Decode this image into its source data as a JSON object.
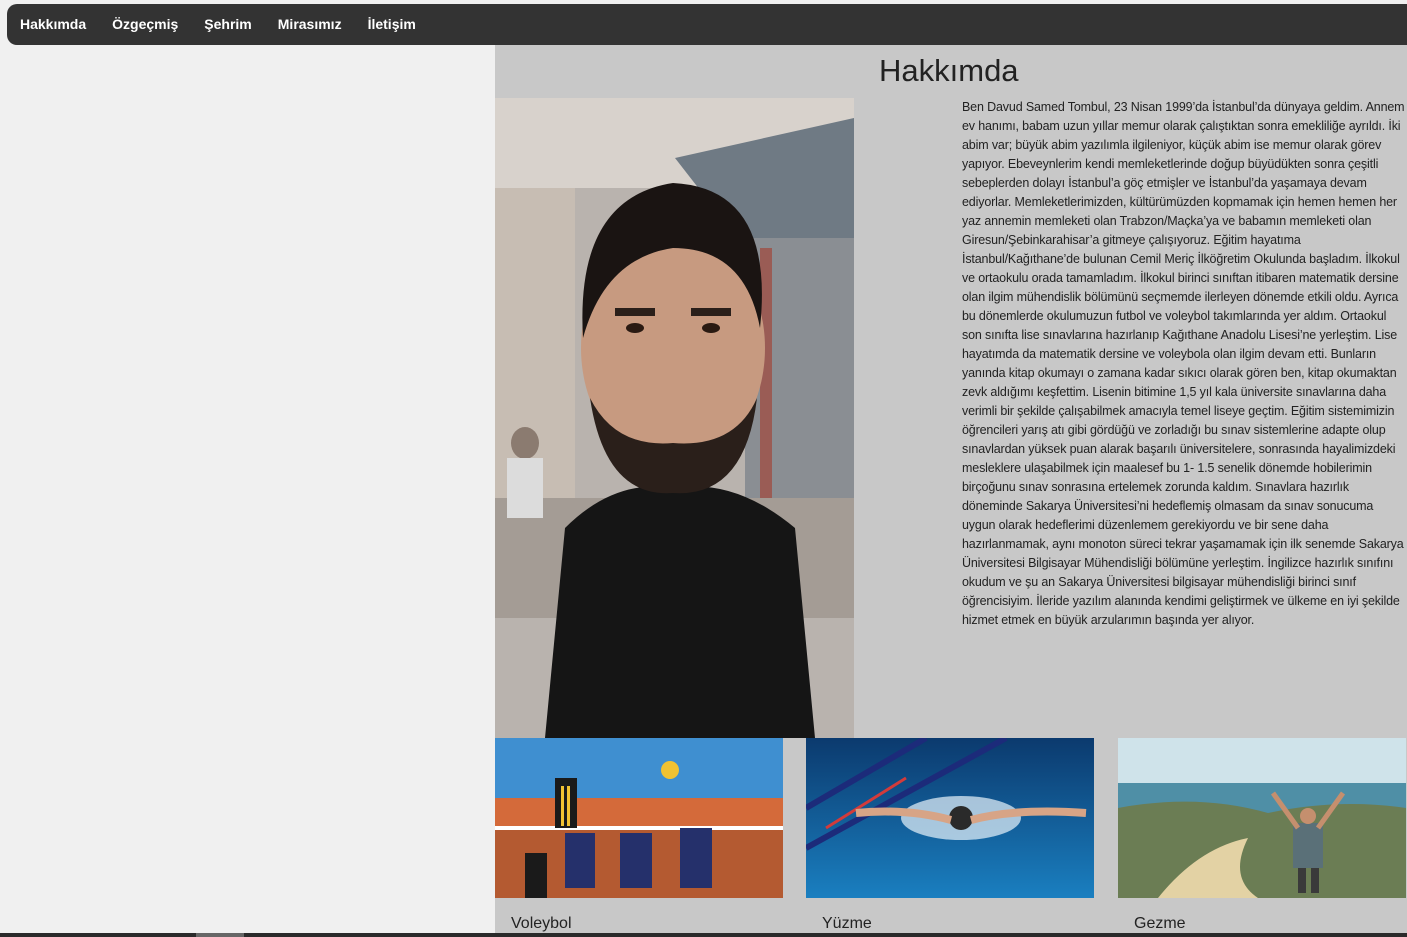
{
  "nav": {
    "items": [
      "Hakkımda",
      "Özgeçmiş",
      "Şehrim",
      "Mirasımız",
      "İletişim"
    ]
  },
  "main": {
    "title": "Hakkımda",
    "about": "Ben Davud Samed Tombul, 23 Nisan 1999’da İstanbul’da dünyaya geldim. Annem ev hanımı, babam uzun yıllar memur olarak çalıştıktan sonra emekliliğe ayrıldı. İki abim var; büyük abim yazılımla ilgileniyor, küçük abim ise memur olarak görev yapıyor. Ebeveynlerim kendi memleketlerinde doğup büyüdükten sonra çeşitli sebeplerden dolayı İstanbul’a göç etmişler ve İstanbul’da yaşamaya devam ediyorlar. Memleketlerimizden, kültürümüzden kopmamak için hemen hemen her yaz annemin memleketi olan Trabzon/Maçka’ya ve babamın memleketi olan Giresun/Şebinkarahisar’a gitmeye çalışıyoruz. Eğitim hayatıma İstanbul/Kağıthane’de bulunan Cemil Meriç İlköğretim Okulunda başladım. İlkokul ve ortaokulu orada tamamladım. İlkokul birinci sınıftan itibaren matematik dersine olan ilgim mühendislik bölümünü seçmemde ilerleyen dönemde etkili oldu. Ayrıca bu dönemlerde okulumuzun futbol ve voleybol takımlarında yer aldım. Ortaokul son sınıfta lise sınavlarına hazırlanıp Kağıthane Anadolu Lisesi’ne yerleştim. Lise hayatımda da matematik dersine ve voleybola olan ilgim devam etti. Bunların yanında kitap okumayı o zamana kadar sıkıcı olarak gören ben, kitap okumaktan zevk aldığımı keşfettim. Lisenin bitimine 1,5 yıl kala üniversite sınavlarına daha verimli bir şekilde çalışabilmek amacıyla temel liseye geçtim. Eğitim sistemimizin öğrencileri yarış atı gibi gördüğü ve zorladığı bu sınav sistemlerine adapte olup sınavlardan yüksek puan alarak başarılı üniversitelere, sonrasında hayalimizdeki mesleklere ulaşabilmek için maalesef bu 1- 1.5 senelik dönemde hobilerimin birçoğunu sınav sonrasına ertelemek zorunda kaldım. Sınavlara hazırlık döneminde Sakarya Üniversitesi’ni hedeflemiş olmasam da sınav sonucuma uygun olarak hedeflerimi düzenlemem gerekiyordu ve bir sene daha hazırlanmamak, aynı monoton süreci tekrar yaşamamak için ilk senemde Sakarya Üniversitesi Bilgisayar Mühendisliği bölümüne yerleştim. İngilizce hazırlık sınıfını okudum ve şu an Sakarya Üniversitesi bilgisayar mühendisliği birinci sınıf öğrencisiyim. İleride yazılım alanında kendimi geliştirmek ve ülkeme en iyi şekilde hizmet etmek en büyük arzularımın başında yer alıyor."
  },
  "hobbies": [
    {
      "label": "Voleybol",
      "icon": "volleyball-photo"
    },
    {
      "label": "Yüzme",
      "icon": "swimming-photo"
    },
    {
      "label": "Gezme",
      "icon": "travel-photo"
    }
  ]
}
